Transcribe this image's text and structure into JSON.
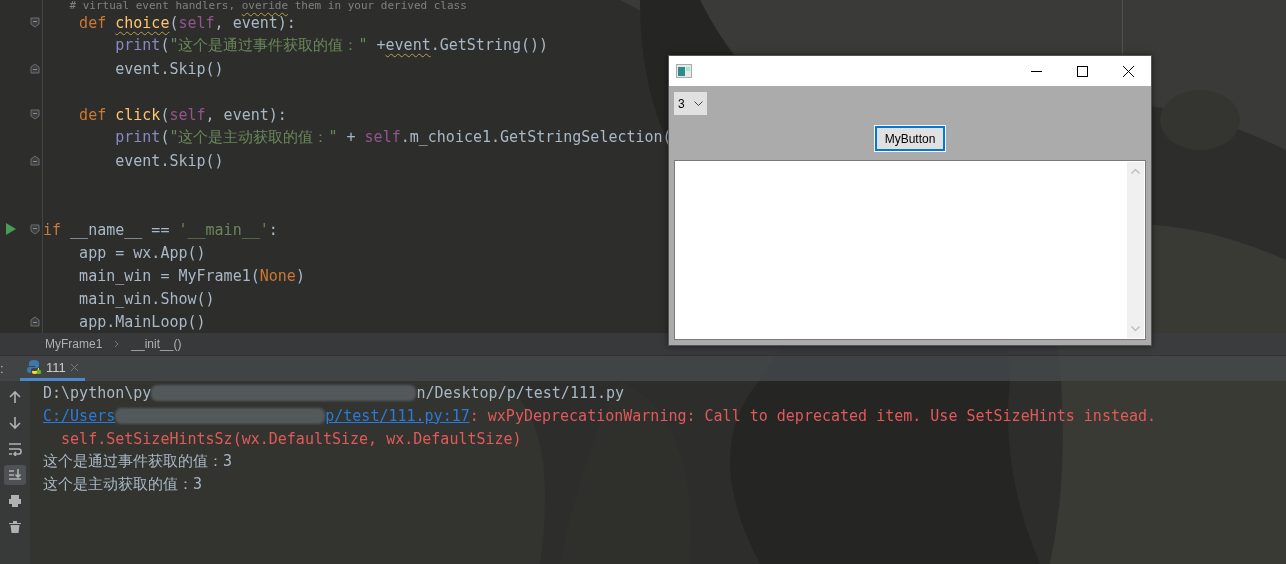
{
  "editor": {
    "lines": [
      {
        "kind": "none",
        "tokens": [
          {
            "t": "    # virtual event handlers, ",
            "kind": "comment"
          },
          {
            "t": "overide",
            "kind": "commentwarn"
          },
          {
            "t": " them in your derived class",
            "kind": "comment"
          }
        ]
      },
      {
        "kind": "fold-start",
        "tokens": [
          {
            "t": "    def ",
            "kind": "kw"
          },
          {
            "t": "choice",
            "kind": "fnwarn"
          },
          {
            "t": "(",
            "kind": "plain"
          },
          {
            "t": "self",
            "kind": "self"
          },
          {
            "t": ", event):",
            "kind": "plain"
          }
        ]
      },
      {
        "kind": "none",
        "tokens": [
          {
            "t": "        print",
            "kind": "builtin"
          },
          {
            "t": "(",
            "kind": "plain"
          },
          {
            "t": "\"这个是通过事件获取的值：\"",
            "kind": "str"
          },
          {
            "t": " +",
            "kind": "plain"
          },
          {
            "t": "event",
            "kind": "plainwarn"
          },
          {
            "t": ".GetString())",
            "kind": "plain"
          }
        ]
      },
      {
        "kind": "fold-end",
        "tokens": [
          {
            "t": "        event.Skip()",
            "kind": "plain"
          }
        ]
      },
      {
        "kind": "none"
      },
      {
        "kind": "fold-start",
        "tokens": [
          {
            "t": "    def ",
            "kind": "kw"
          },
          {
            "t": "click",
            "kind": "fn"
          },
          {
            "t": "(",
            "kind": "plain"
          },
          {
            "t": "self",
            "kind": "self"
          },
          {
            "t": ", event):",
            "kind": "plain"
          }
        ]
      },
      {
        "kind": "none",
        "tokens": [
          {
            "t": "        print",
            "kind": "builtin"
          },
          {
            "t": "(",
            "kind": "plain"
          },
          {
            "t": "\"这个是主动获取的值：\"",
            "kind": "str"
          },
          {
            "t": " + ",
            "kind": "plain"
          },
          {
            "t": "self",
            "kind": "self"
          },
          {
            "t": ".m_choice1.GetStringSelection(",
            "kind": "plain"
          }
        ]
      },
      {
        "kind": "fold-end",
        "tokens": [
          {
            "t": "        event.Skip()",
            "kind": "plain"
          }
        ]
      },
      {
        "kind": "none"
      },
      {
        "kind": "none"
      },
      {
        "kind": "run-fold-start",
        "tokens": [
          {
            "t": "if ",
            "kind": "kw"
          },
          {
            "t": "__name__ == ",
            "kind": "plain"
          },
          {
            "t": "'__main__'",
            "kind": "str"
          },
          {
            "t": ":",
            "kind": "plain"
          }
        ]
      },
      {
        "kind": "none",
        "tokens": [
          {
            "t": "    app = wx.App()",
            "kind": "plain"
          }
        ]
      },
      {
        "kind": "none",
        "tokens": [
          {
            "t": "    main_win = MyFrame1(",
            "kind": "plain"
          },
          {
            "t": "None",
            "kind": "kw"
          },
          {
            "t": ")",
            "kind": "plain"
          }
        ]
      },
      {
        "kind": "none",
        "tokens": [
          {
            "t": "    main_win.Show()",
            "kind": "plain"
          }
        ]
      },
      {
        "kind": "fold-end",
        "tokens": [
          {
            "t": "    app.MainLoop()",
            "kind": "plain"
          }
        ]
      }
    ]
  },
  "breadcrumbs": [
    "MyFrame1",
    "__init__()"
  ],
  "run_panel": {
    "prefix": ":",
    "tabs": [
      {
        "label": "111",
        "selected": true
      }
    ],
    "tools": [
      {
        "kind": "up",
        "selected": false
      },
      {
        "kind": "down",
        "selected": false
      },
      {
        "kind": "wrap",
        "selected": false
      },
      {
        "kind": "scroll-end",
        "selected": true
      },
      {
        "kind": "print",
        "selected": false
      },
      {
        "kind": "trash",
        "selected": false
      }
    ],
    "lines": [
      {
        "segments": [
          {
            "kind": "plain",
            "text": "D:\\python\\py"
          },
          {
            "kind": "redacted"
          },
          {
            "kind": "plain",
            "text": "n/Desktop/p/test/111.py"
          }
        ]
      },
      {
        "segments": [
          {
            "kind": "link",
            "text": "C:/Users"
          },
          {
            "kind": "redacted"
          },
          {
            "kind": "link",
            "text": "p/test/111.py:17"
          },
          {
            "kind": "error",
            "text": ": wxPyDeprecationWarning: Call to deprecated item. Use SetSizeHints instead."
          }
        ]
      },
      {
        "segments": [
          {
            "kind": "error",
            "text": "  self.SetSizeHintsSz(wx.DefaultSize, wx.DefaultSize)"
          }
        ]
      },
      {
        "segments": [
          {
            "kind": "plain",
            "text": "这个是通过事件获取的值：3"
          }
        ]
      },
      {
        "segments": [
          {
            "kind": "plain",
            "text": "这个是主动获取的值：3"
          }
        ]
      }
    ]
  },
  "app_window": {
    "choice": {
      "value": "3"
    },
    "button": {
      "label": "MyButton",
      "focused": true
    }
  }
}
